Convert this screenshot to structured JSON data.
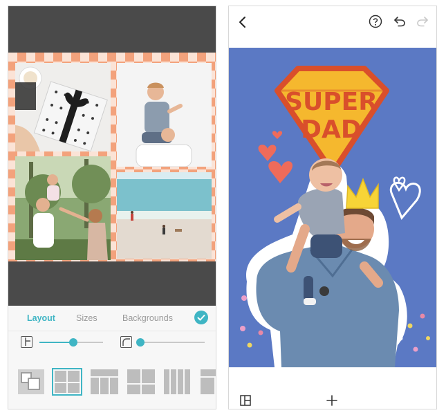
{
  "left_screen": {
    "tabs": [
      {
        "label": "Layout",
        "active": true
      },
      {
        "label": "Sizes",
        "active": false
      },
      {
        "label": "Backgrounds",
        "active": false
      }
    ],
    "confirm_icon": "check-circle-icon",
    "sliders": [
      {
        "icon": "border-width-icon",
        "value": 0.53
      },
      {
        "icon": "corner-radius-icon",
        "value": 0.05
      }
    ],
    "layouts": [
      {
        "name": "overlap",
        "selected": false
      },
      {
        "name": "grid-2x2",
        "selected": true
      },
      {
        "name": "top-plus-3",
        "selected": false
      },
      {
        "name": "two-by-two-wide",
        "selected": false
      },
      {
        "name": "four-columns",
        "selected": false
      },
      {
        "name": "rows",
        "selected": false
      }
    ],
    "colors": {
      "accent": "#3fb5c4",
      "dark_bar": "#4a4a4a",
      "pattern": "#f3a27c"
    }
  },
  "right_screen": {
    "icons": {
      "back": "back-chevron-icon",
      "help": "help-circle-icon",
      "undo": "undo-icon",
      "redo": "redo-icon",
      "layout": "layout-icon",
      "add": "add-plus-icon"
    },
    "sticker_text": {
      "line1": "SUPER",
      "line2": "DAD"
    },
    "colors": {
      "canvas": "#5b79c4",
      "badge": "#f5b82e",
      "badge_outline": "#d94f2b",
      "crown": "#f7d437"
    }
  }
}
